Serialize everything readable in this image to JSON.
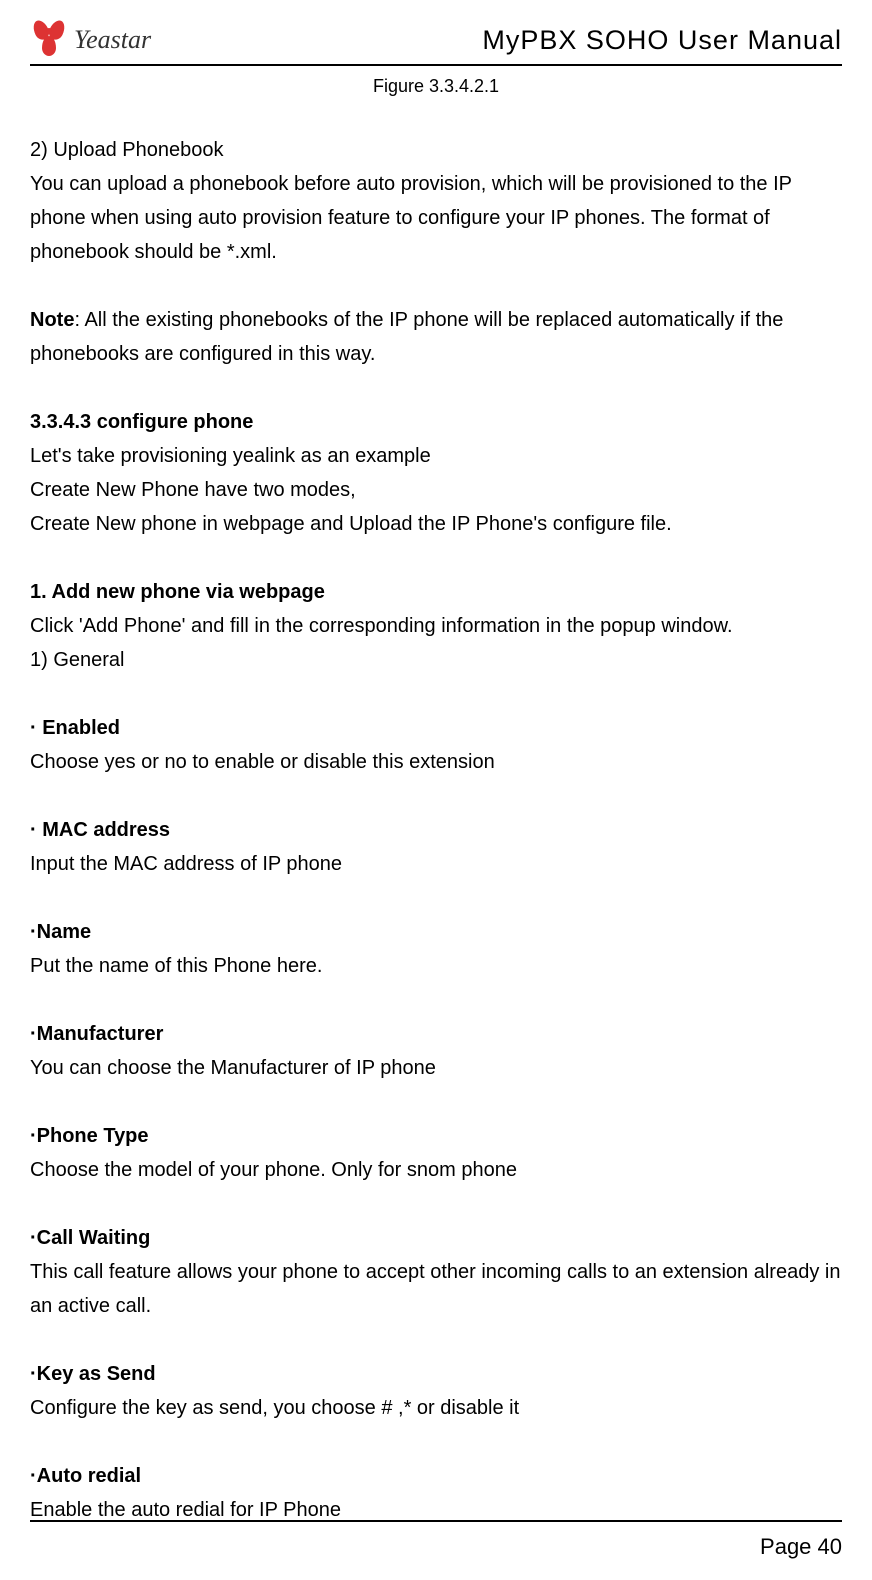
{
  "header": {
    "brand": "Yeastar",
    "doc_title": "MyPBX SOHO User Manual"
  },
  "figure_caption": "Figure 3.3.4.2.1",
  "section_upload": {
    "heading": "2) Upload Phonebook",
    "p1": "You can upload a phonebook before auto provision, which will be provisioned to the IP phone when using auto provision feature to configure your IP phones. The format of phonebook should be *.xml."
  },
  "note": {
    "label": "Note",
    "text": ": All the existing phonebooks of the IP phone will be replaced automatically if the phonebooks are configured in this way."
  },
  "section_configure": {
    "heading": "3.3.4.3   configure phone",
    "l1": "Let's take provisioning yealink as an example",
    "l2": "Create New Phone have two modes,",
    "l3": "Create New phone in webpage and Upload the IP Phone's configure file."
  },
  "section_add": {
    "heading": "1. Add new phone via webpage",
    "intro": "Click 'Add Phone' and fill in the corresponding information in the popup window.",
    "sub": "1) General"
  },
  "fields": [
    {
      "label": "· Enabled",
      "desc": "Choose yes or no to enable or disable this extension"
    },
    {
      "label": "· MAC address",
      "desc": "Input the MAC address of IP phone"
    },
    {
      "label": "·Name",
      "desc": "Put the name of this Phone here."
    },
    {
      "label": "·Manufacturer",
      "desc": "You can choose the Manufacturer of IP phone"
    },
    {
      "label": "·Phone Type",
      "desc": "Choose the model of your phone. Only for snom phone"
    },
    {
      "label": "·Call Waiting",
      "desc": "This call feature allows your phone to accept other incoming calls to an extension already in an active call."
    },
    {
      "label": "·Key as Send",
      "desc": "Configure the key as send, you choose # ,* or disable it"
    },
    {
      "label": "·Auto redial",
      "desc": "Enable the auto redial for IP Phone"
    }
  ],
  "footer": {
    "page": "Page 40"
  }
}
